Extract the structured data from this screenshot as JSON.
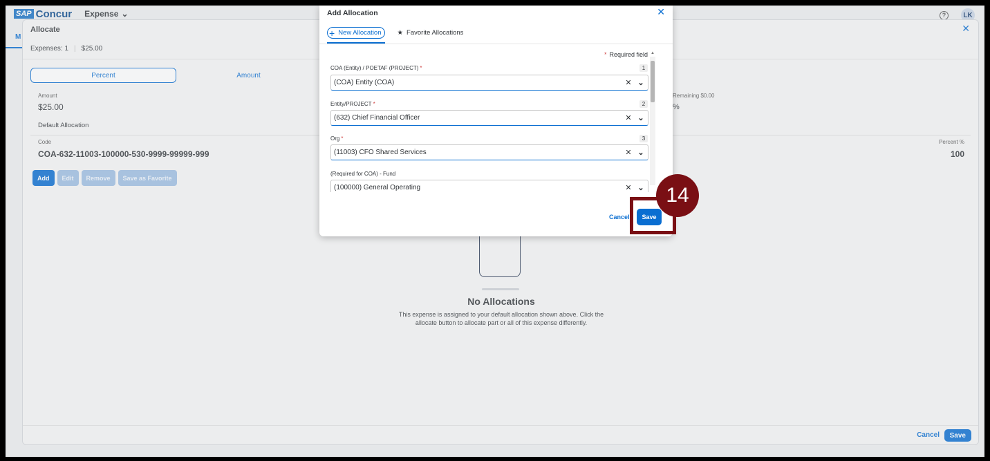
{
  "shell": {
    "logo_sap": "SAP",
    "logo_brand": "Concur",
    "app_menu": "Expense",
    "avatar_initials": "LK",
    "side_tab_initial": "M"
  },
  "allocate": {
    "title": "Allocate",
    "expenses_count": "Expenses: 1",
    "expenses_total": "$25.00",
    "segments": [
      "Percent",
      "Amount"
    ],
    "amount_label": "Amount",
    "amount_value": "$25.00",
    "default_allocation": "Default Allocation",
    "code_label": "Code",
    "code_value": "COA-632-11003-100000-530-9999-99999-999",
    "remaining": "Remaining $0.00",
    "pct_mark": "%",
    "percent_label": "Percent %",
    "percent_value": "100",
    "buttons": {
      "add": "Add",
      "edit": "Edit",
      "remove": "Remove",
      "save_fav": "Save as Favorite"
    },
    "empty": {
      "title": "No Allocations",
      "text": "This expense is assigned to your default allocation shown above. Click the allocate button to allocate part or all of this expense differently."
    },
    "footer": {
      "cancel": "Cancel",
      "save": "Save"
    }
  },
  "modal": {
    "title": "Add Allocation",
    "tabs": [
      {
        "label": "New Allocation",
        "icon": "plus-icon"
      },
      {
        "label": "Favorite Allocations",
        "icon": "star-icon"
      }
    ],
    "required_note": "Required field",
    "fields": [
      {
        "label": "COA (Entity) / POETAF (PROJECT)",
        "required": true,
        "num": "1",
        "value": "(COA) Entity (COA)"
      },
      {
        "label": "Entity/PROJECT",
        "required": true,
        "num": "2",
        "value": "(632) Chief Financial Officer"
      },
      {
        "label": "Org",
        "required": true,
        "num": "3",
        "value": "(11003) CFO Shared Services"
      },
      {
        "label": "(Required for COA) - Fund",
        "required": false,
        "num": "",
        "value": "(100000) General Operating"
      }
    ],
    "cancel": "Cancel",
    "save": "Save"
  },
  "callout": {
    "step": "14"
  },
  "colors": {
    "accent": "#0a6ed1",
    "callout": "#7a0f14",
    "required": "#d04343"
  }
}
